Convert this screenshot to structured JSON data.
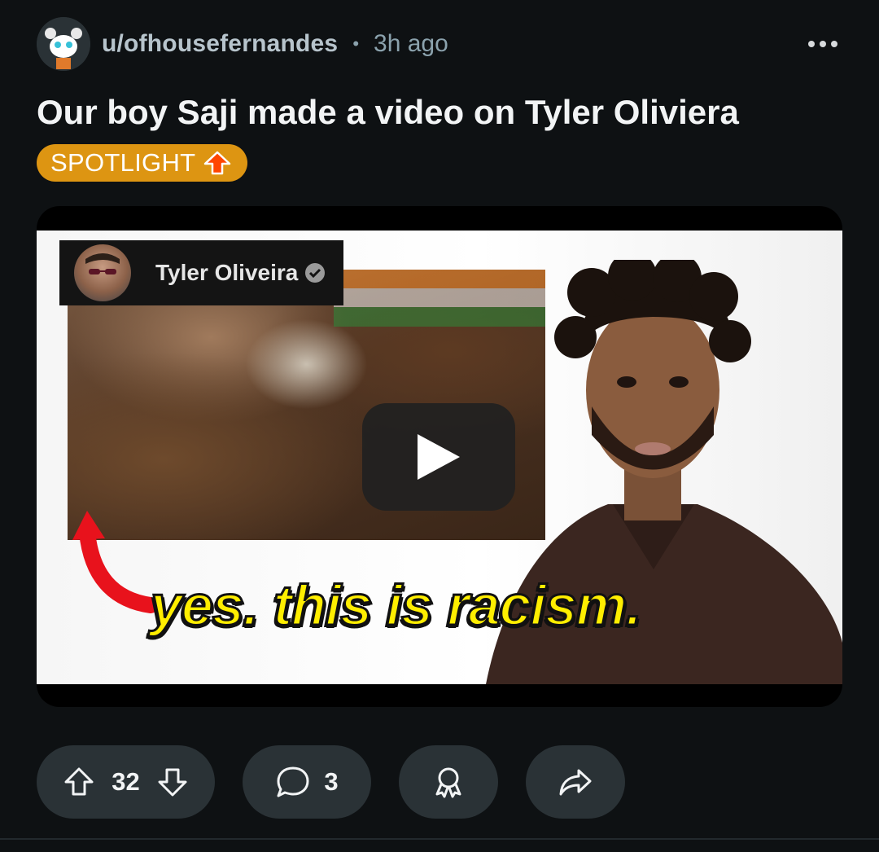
{
  "post": {
    "author": "u/ofhousefernandes",
    "separator": "•",
    "time": "3h ago",
    "title": "Our boy Saji made a video on Tyler Oliviera",
    "flair": "SPOTLIGHT"
  },
  "video": {
    "channel_name": "Tyler Oliveira",
    "caption": "yes. this is racism."
  },
  "actions": {
    "upvotes": "32",
    "comments": "3"
  },
  "colors": {
    "background": "#0e1113",
    "flair": "#dd9512",
    "pill": "#2a3236",
    "caption_yellow": "#ffee00",
    "arrow_red": "#e8121c"
  },
  "icons": {
    "more": "more-horizontal-icon",
    "flair": "upvote-arrow-icon",
    "verified": "verified-check-icon",
    "play": "play-icon",
    "upvote": "upvote-icon",
    "downvote": "downvote-icon",
    "comment": "comment-icon",
    "award": "award-icon",
    "share": "share-icon"
  }
}
